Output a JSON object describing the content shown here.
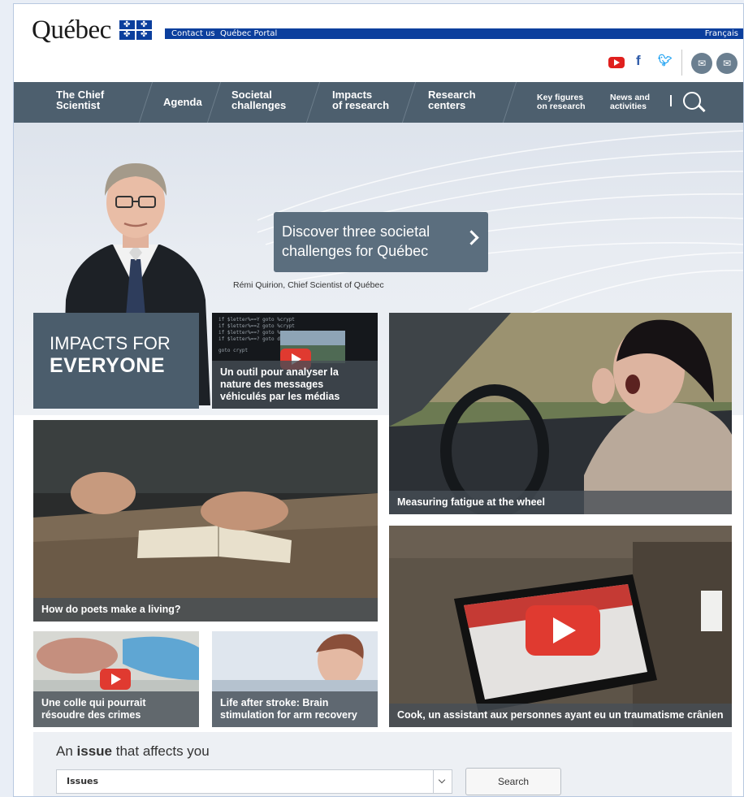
{
  "header": {
    "logo_text": "Québec",
    "contact_label": "Contact us",
    "portal_label": "Québec Portal",
    "lang_label": "Français"
  },
  "nav": {
    "items": [
      {
        "l1": "The Chief",
        "l2": "Scientist"
      },
      {
        "l1": "Agenda",
        "l2": ""
      },
      {
        "l1": "Societal",
        "l2": "challenges"
      },
      {
        "l1": "Impacts",
        "l2": "of research"
      },
      {
        "l1": "Research",
        "l2": "centers"
      },
      {
        "l1": "Key figures",
        "l2": "on research"
      },
      {
        "l1": "News and",
        "l2": "activities"
      }
    ]
  },
  "hero": {
    "cta_l1": "Discover three societal",
    "cta_l2": "challenges for Québec",
    "caption": "Rémi Quirion, Chief Scientist of Québec"
  },
  "impacts": {
    "line1": "IMPACTS FOR",
    "line2": "EVERYONE"
  },
  "tiles": [
    {
      "label": "Un outil pour analyser la nature des messages véhiculés par les médias"
    },
    {
      "label": "Measuring fatigue at the wheel"
    },
    {
      "label": "How do poets make a living?"
    },
    {
      "label": "Une colle qui pourrait résoudre des crimes"
    },
    {
      "label": "Life after stroke: Brain stimulation for arm recovery"
    },
    {
      "label": "Cook, un assistant aux personnes ayant eu un traumatisme crânien"
    }
  ],
  "issue": {
    "title_prefix": "An ",
    "title_bold": "issue",
    "title_suffix": " that affects you",
    "select_value": "Issues",
    "search_label": "Search"
  }
}
